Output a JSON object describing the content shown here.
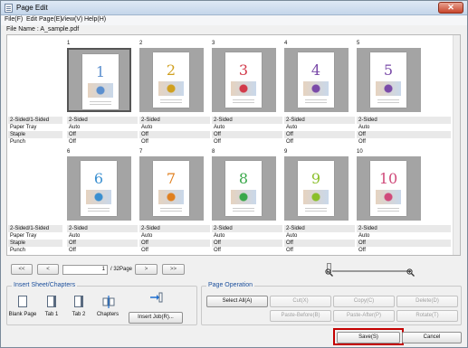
{
  "window": {
    "title": "Page Edit"
  },
  "menu": [
    "File(F)",
    "Edit Page(E)",
    "View(V)",
    "Help(H)"
  ],
  "file": {
    "label": "File Name : A_sample.pdf"
  },
  "row_labels": [
    "2-Sided/1-Sided",
    "Paper Tray",
    "Staple",
    "Punch"
  ],
  "pages": [
    {
      "number": "1",
      "values": [
        "2-Sided",
        "Auto",
        "Off",
        "Off"
      ],
      "selected": true,
      "digit_color": "#5b8fcf"
    },
    {
      "number": "2",
      "values": [
        "2-Sided",
        "Auto",
        "Off",
        "Off"
      ],
      "digit_color": "#d0a020"
    },
    {
      "number": "3",
      "values": [
        "2-Sided",
        "Auto",
        "Off",
        "Off"
      ],
      "digit_color": "#d23a4a"
    },
    {
      "number": "4",
      "values": [
        "2-Sided",
        "Auto",
        "Off",
        "Off"
      ],
      "digit_color": "#7a4aa8"
    },
    {
      "number": "5",
      "values": [
        "2-Sided",
        "Auto",
        "Off",
        "Off"
      ],
      "digit_color": "#7a4aa8"
    },
    {
      "number": "6",
      "values": [
        "2-Sided",
        "Auto",
        "Off",
        "Off"
      ],
      "digit_color": "#3a8fd0"
    },
    {
      "number": "7",
      "values": [
        "2-Sided",
        "Auto",
        "Off",
        "Off"
      ],
      "digit_color": "#e08020"
    },
    {
      "number": "8",
      "values": [
        "2-Sided",
        "Auto",
        "Off",
        "Off"
      ],
      "digit_color": "#3aa84a"
    },
    {
      "number": "9",
      "values": [
        "2-Sided",
        "Auto",
        "Off",
        "Off"
      ],
      "digit_color": "#8abf2a"
    },
    {
      "number": "10",
      "values": [
        "2-Sided",
        "Auto",
        "Off",
        "Off"
      ],
      "digit_color": "#d04a7a"
    }
  ],
  "navigation": {
    "first": "<<",
    "prev": "<",
    "page_value": "1",
    "total": "/ 32Page",
    "next": ">",
    "last": ">>"
  },
  "insert_group": {
    "title": "Insert Sheet/Chapters",
    "tools": [
      "Blank Page",
      "Tab 1",
      "Tab 2",
      "Chapters"
    ],
    "insert_job": "Insert Job(R)..."
  },
  "page_operation": {
    "title": "Page Operation",
    "select_all": "Select All(A)",
    "cut": "Cut(X)",
    "copy": "Copy(C)",
    "delete": "Delete(D)",
    "paste_before": "Paste-Before(B)",
    "paste_after": "Paste-After(P)",
    "rotate": "Rotate(T)"
  },
  "footer": {
    "save": "Save(S)",
    "cancel": "Cancel"
  },
  "colors": {
    "highlight": "#c40000",
    "group_title": "#1c4f9c",
    "thumb_bg": "#a4a4a4"
  }
}
